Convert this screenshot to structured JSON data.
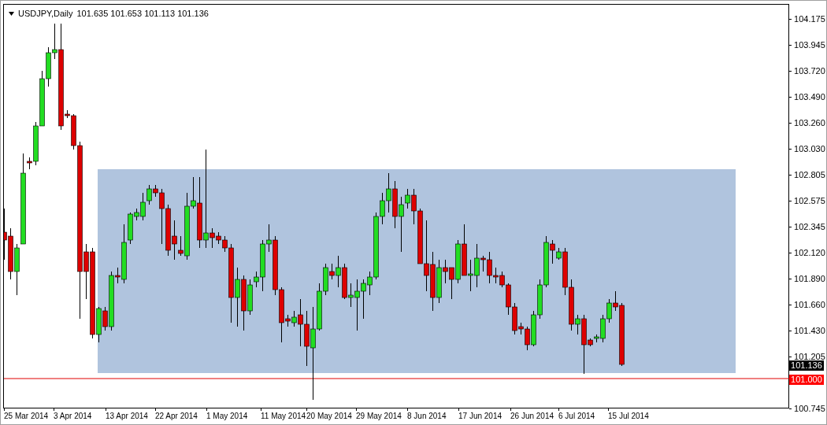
{
  "chart_header": {
    "symbol": "USDJPY,Daily",
    "ohlc": "101.635 101.653 101.113 101.136"
  },
  "price_axis": {
    "ticks": [
      "104.175",
      "103.945",
      "103.720",
      "103.490",
      "103.260",
      "103.030",
      "102.805",
      "102.575",
      "102.345",
      "102.120",
      "101.890",
      "101.660",
      "101.430",
      "101.205",
      "100.745"
    ],
    "current_price": "101.136",
    "level_line_price": "101.000"
  },
  "time_axis": {
    "ticks": [
      "25 Mar 2014",
      "3 Apr 2014",
      "13 Apr 2014",
      "22 Apr 2014",
      "1 May 2014",
      "11 May 2014",
      "20 May 2014",
      "29 May 2014",
      "8 Jun 2014",
      "17 Jun 2014",
      "26 Jun 2014",
      "6 Jul 2014",
      "15 Jul 2014"
    ]
  }
}
